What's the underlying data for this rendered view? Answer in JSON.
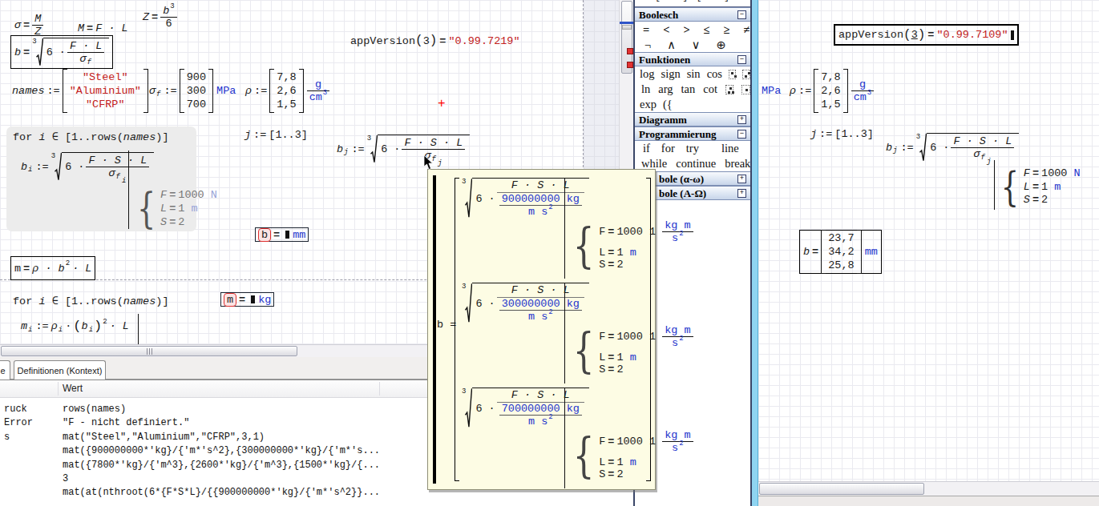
{
  "colors": {
    "unit": "#2233cc",
    "string": "#c22020",
    "red_accent": "#ff0000"
  },
  "left_doc": {
    "sigma_eq": {
      "lhs": "σ",
      "eq": "=",
      "num": "M",
      "den": "Z"
    },
    "moment_eq": {
      "lhs": "M",
      "eq": "=",
      "rhs": "F · L"
    },
    "z_eq": {
      "lhs": "Z",
      "eq": "=",
      "num_base": "b",
      "num_exp": "3",
      "den": "6"
    },
    "b_formula": {
      "lhs": "b",
      "eq": "=",
      "root_index": "3",
      "coef": "6 ·",
      "num": "F · L",
      "den_base": "σ",
      "den_sub": "f"
    },
    "names_def": {
      "lhs": "names",
      "op": ":=",
      "rows": [
        "\"Steel\"",
        "\"Aluminium\"",
        "\"CFRP\""
      ]
    },
    "sigmaf_def": {
      "lhs": "σ",
      "lhs_sub": "f",
      "op": ":=",
      "rows": [
        "900",
        "300",
        "700"
      ],
      "unit": "MPa"
    },
    "rho_def": {
      "lhs": "ρ",
      "op": ":=",
      "rows": [
        "7,8",
        "2,6",
        "1,5"
      ],
      "unit_num": "g",
      "unit_den": "cm",
      "unit_exp": "3"
    },
    "appversion": {
      "fn": "appVersion",
      "open": "(",
      "arg": "3",
      "close": ")",
      "eq": "=",
      "value": "\"0.99.7219\""
    },
    "cursor_plus": "+",
    "for1": {
      "kw": "for",
      "var": "i",
      "in": "∈",
      "seg_open": "[1..rows(",
      "seg_arg": "names",
      "seg_close": ")]"
    },
    "bi_def": {
      "lhs": "b",
      "lhs_sub": "i",
      "op": ":=",
      "root_index": "3",
      "coef": "6 ·",
      "num": "F · S · L",
      "den_base": "σ",
      "den_sub": "f",
      "den_sub2": "i"
    },
    "conds": [
      {
        "var": "F",
        "eq": "=",
        "val": "1000",
        "unit": "N"
      },
      {
        "var": "L",
        "eq": "=",
        "val": "1",
        "unit": "m"
      },
      {
        "var": "S",
        "eq": "=",
        "val": "2",
        "unit": ""
      }
    ],
    "j_def": {
      "lhs": "j",
      "op": ":=",
      "val": "[1..3]"
    },
    "bj_def": {
      "lhs": "b",
      "lhs_sub": "j",
      "op": ":=",
      "root_index": "3",
      "coef": "6 ·",
      "num": "F · S · L",
      "den_base": "σ",
      "den_sub": "f",
      "den_sub2": "j"
    },
    "b_result": {
      "lhs": "b",
      "eq": "=",
      "unit": "mm"
    },
    "m_formula": {
      "lhs": "m",
      "eq": "=",
      "body": "ρ · b",
      "exp": "2",
      "tail": "· L"
    },
    "for2": {
      "kw": "for",
      "var": "i",
      "in": "∈",
      "seg_open": "[1..rows(",
      "seg_arg": "names",
      "seg_close": ")]"
    },
    "mi_def": {
      "lhs": "m",
      "lhs_sub": "i",
      "op": ":=",
      "t1": "ρ",
      "t1_sub": "i",
      "dot": "·",
      "p_open": "(",
      "t2": "b",
      "t2_sub": "i",
      "p_close": ")",
      "exp": "2",
      "tail": "· L"
    },
    "m_result": {
      "lhs": "m",
      "eq": "=",
      "unit": "kg"
    }
  },
  "sidebar": {
    "top_icons": [
      "■",
      "[...]",
      "[...]",
      "■.",
      "■.."
    ],
    "boolesch": {
      "title": "Boolesch",
      "toggle": "−",
      "row1": [
        "=",
        "<",
        ">",
        "≤",
        "≥",
        "≠"
      ],
      "row2": [
        "¬",
        "∧",
        "∨",
        "⊕"
      ]
    },
    "funktionen": {
      "title": "Funktionen",
      "toggle": "−",
      "row1": [
        "log",
        "sign",
        "sin",
        "cos"
      ],
      "row2": [
        "ln",
        "arg",
        "tan",
        "cot"
      ],
      "row3": [
        "exp"
      ],
      "icon3": "({"
    },
    "diagramm": {
      "title": "Diagramm",
      "toggle": "+"
    },
    "programmierung": {
      "title": "Programmierung",
      "toggle": "−",
      "row1": [
        "if",
        "for",
        "try",
        "line"
      ],
      "row2": [
        "while",
        "continue",
        "break"
      ]
    },
    "symbole_lower": {
      "title": "bole (α-ω)",
      "toggle": "+"
    },
    "symbole_upper": {
      "title": "bole (Α-Ω)",
      "toggle": "+"
    }
  },
  "bottom_panel": {
    "tab_partial": "e",
    "tab_active": "Definitionen (Kontext)",
    "header": "Wert",
    "rows": [
      {
        "label": "ruck",
        "value": "rows(names)"
      },
      {
        "label": "Error",
        "value": "\"F - nicht definiert.\""
      },
      {
        "label": "s",
        "value": "mat(\"Steel\",\"Aluminium\",\"CFRP\",3,1)"
      },
      {
        "label": "",
        "value": "mat({900000000*'kg}/{'m*'s^2},{300000000*'kg}/{'m*'s..."
      },
      {
        "label": "",
        "value": "mat({7800*'kg}/{'m^3},{2600*'kg}/{'m^3},{1500*'kg}/{..."
      },
      {
        "label": "",
        "value": "3"
      },
      {
        "label": "",
        "value": "mat(at(nthroot(6*{F*S*L}/{{900000000*'kg}/{'m*'s^2}}..."
      }
    ]
  },
  "right_doc": {
    "appversion": {
      "fn": "appVersion",
      "open": "(",
      "arg": "3",
      "close": ")",
      "eq": "=",
      "value": "\"0.99.7109\""
    },
    "unit_label": "MPa",
    "rho_def": {
      "lhs": "ρ",
      "op": ":=",
      "rows": [
        "7,8",
        "2,6",
        "1,5"
      ],
      "unit_num": "g",
      "unit_den": "cm",
      "unit_exp": "3"
    },
    "j_def": {
      "lhs": "j",
      "op": ":=",
      "val": "[1..3]"
    },
    "bj_def": {
      "lhs": "b",
      "lhs_sub": "j",
      "op": ":=",
      "root_index": "3",
      "coef": "6 ·",
      "num": "F · S · L",
      "den_base": "σ",
      "den_sub": "f",
      "den_sub2": "j"
    },
    "conds": [
      {
        "var": "F",
        "eq": "=",
        "val": "1000",
        "unit": "N"
      },
      {
        "var": "L",
        "eq": "=",
        "val": "1",
        "unit": "m"
      },
      {
        "var": "S",
        "eq": "=",
        "val": "2",
        "unit": ""
      }
    ],
    "b_result": {
      "lhs": "b",
      "eq": "=",
      "rows": [
        "23,7",
        "34,2",
        "25,8"
      ],
      "unit": "mm"
    }
  },
  "tooltip": {
    "lhs": "b =",
    "root_index": "3",
    "coef": "6 ·",
    "num": "F · S · L",
    "den2": "m s",
    "den2_exp": "2",
    "blocks": [
      {
        "den": "900000000 kg"
      },
      {
        "den": "300000000 kg"
      },
      {
        "den": "700000000 kg"
      }
    ],
    "conds": {
      "f_var": "F",
      "f_eq": "=",
      "f_val": "1000 1",
      "f_num": "kg m",
      "f_den": "s",
      "f_exp": "2",
      "l_var": "L",
      "l_eq": "=",
      "l_val": "1",
      "l_unit": "m",
      "s_var": "S",
      "s_eq": "=",
      "s_val": "2"
    }
  }
}
